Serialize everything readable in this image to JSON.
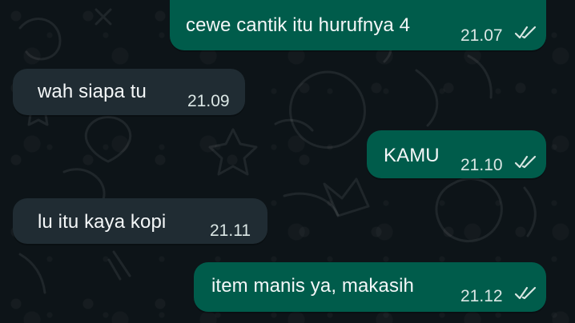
{
  "messages": [
    {
      "text": "cewe cantik itu hurufnya 4",
      "time": "21.07",
      "direction": "outgoing",
      "status_icon": "double-check-icon"
    },
    {
      "text": "wah siapa tu",
      "time": "21.09",
      "direction": "incoming"
    },
    {
      "text": "KAMU",
      "time": "21.10",
      "direction": "outgoing",
      "status_icon": "double-check-icon"
    },
    {
      "text": "lu itu kaya kopi",
      "time": "21.11",
      "direction": "incoming"
    },
    {
      "text": "item manis ya, makasih",
      "time": "21.12",
      "direction": "outgoing",
      "status_icon": "double-check-icon"
    }
  ],
  "colors": {
    "background": "#0d1418",
    "outgoing_bubble": "#005c4b",
    "incoming_bubble": "#202c33",
    "text": "#f4f7f8"
  }
}
